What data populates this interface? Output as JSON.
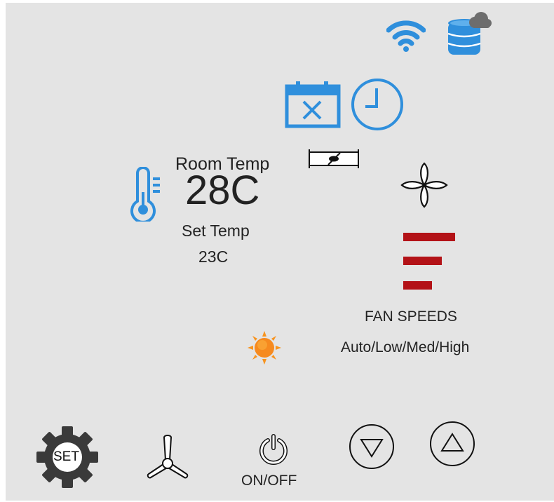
{
  "status_icons": {
    "wifi": "wifi-icon",
    "cloud_storage": "cloud-database-icon"
  },
  "schedule_icons": {
    "calendar": "calendar-cancel-icon",
    "clock": "clock-icon"
  },
  "temperature": {
    "room_label": "Room Temp",
    "room_value": "28C",
    "set_label": "Set Temp",
    "set_value": "23C",
    "thermometer_icon": "thermometer-icon"
  },
  "indicator_icon": "damper-icon",
  "fan": {
    "icon": "fan-icon",
    "speeds_title": "FAN SPEEDS",
    "speeds_options": "Auto/Low/Med/High",
    "speed_bar_color": "#b31217",
    "speed_levels": 3
  },
  "mode_icon": "sun-icon",
  "controls": {
    "set_label": "SET",
    "fan_button_icon": "ceiling-fan-icon",
    "power_label": "ON/OFF",
    "down_icon": "triangle-down-icon",
    "up_icon": "triangle-up-icon"
  },
  "colors": {
    "accent_blue": "#2f8fdc",
    "panel_background": "#e4e4e4",
    "sun_orange": "#f7931e",
    "gear_dark": "#3a3a3a"
  }
}
